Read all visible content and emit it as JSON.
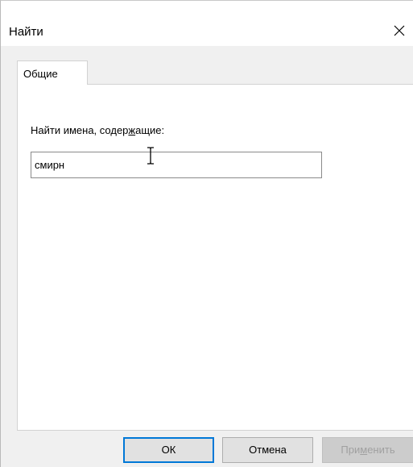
{
  "window": {
    "title": "Найти",
    "close_icon": "close-icon"
  },
  "tabs": [
    {
      "label": "Общие",
      "selected": true
    }
  ],
  "search": {
    "label_before": "Найти имена, содер",
    "label_accel": "ж",
    "label_after": "ащие:",
    "value": "смирн"
  },
  "buttons": {
    "ok": "ОК",
    "cancel": "Отмена",
    "apply_before": "При",
    "apply_accel": "м",
    "apply_after": "енить",
    "apply_enabled": false
  },
  "colors": {
    "accent": "#0078d7",
    "dialog_bg": "#f0f0f0",
    "disabled_text": "#a0a0a0"
  }
}
